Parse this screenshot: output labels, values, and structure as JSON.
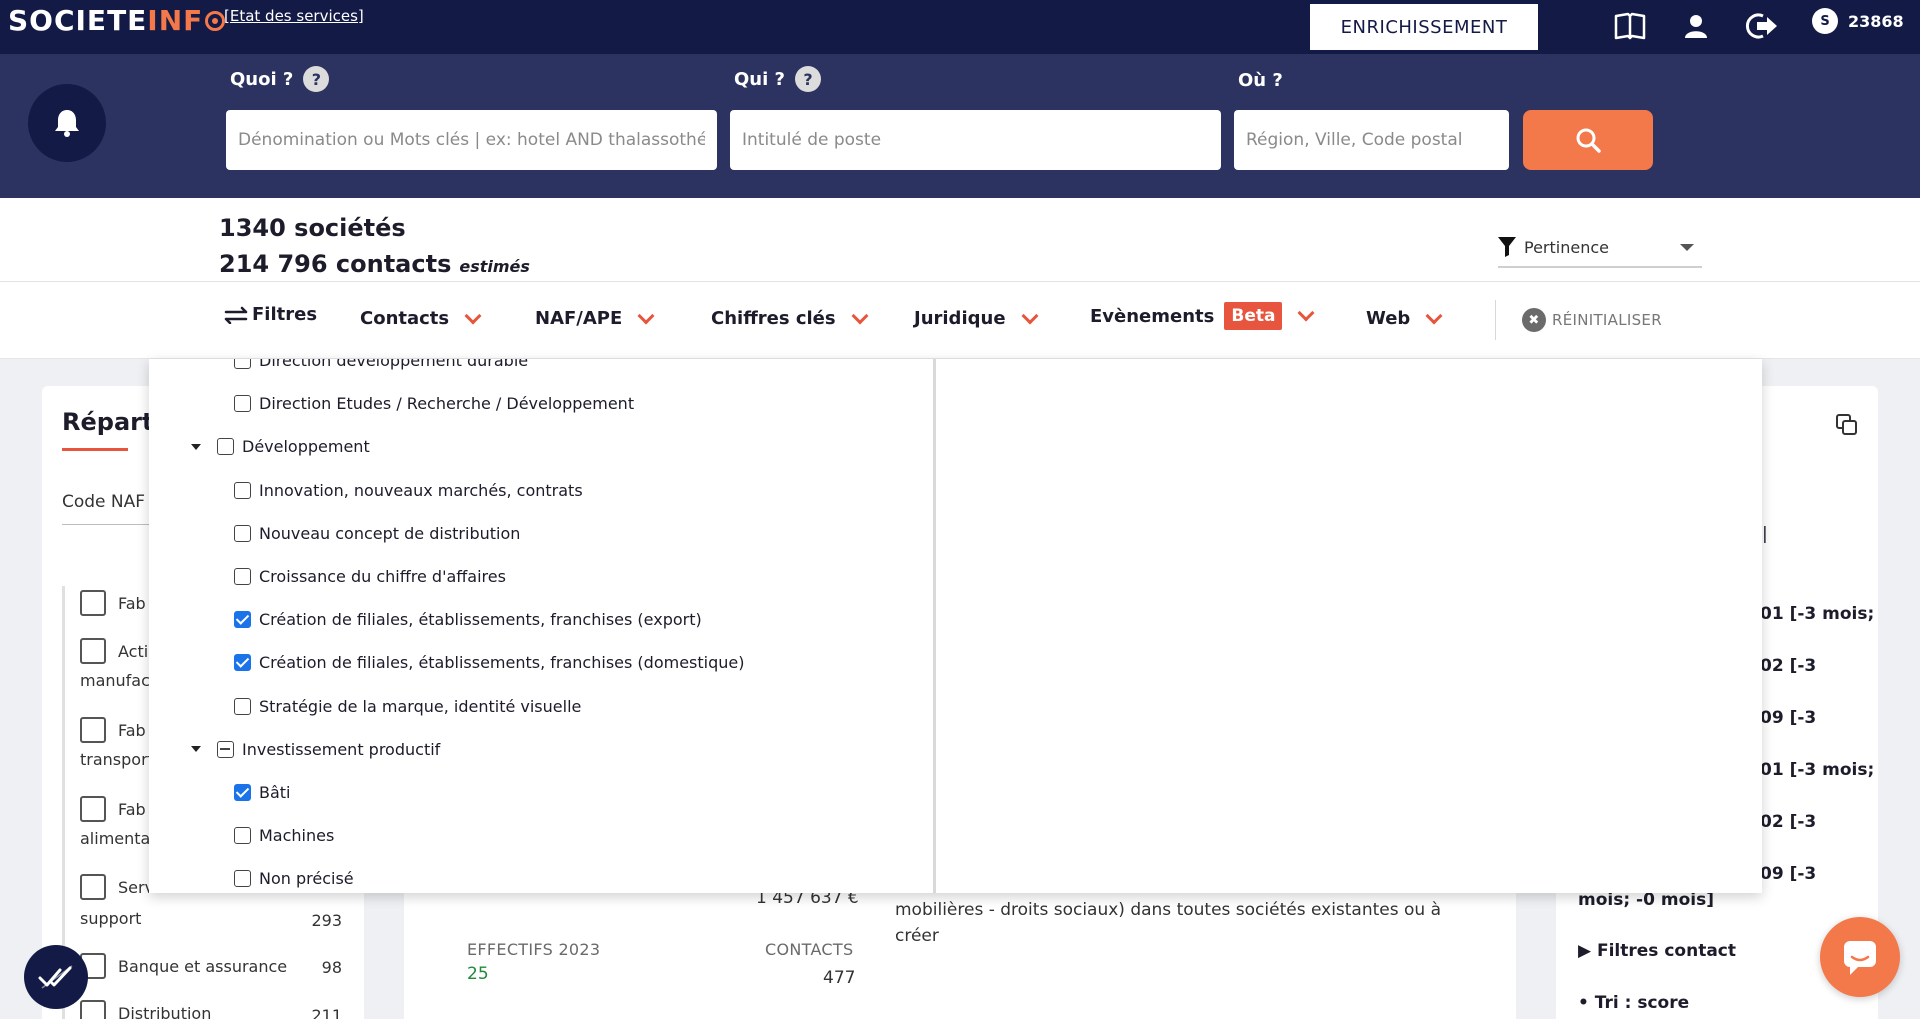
{
  "topbar": {
    "logo_part1": "SOCIETE",
    "logo_part2": "INF",
    "services_link": "[Etat des services]",
    "enrich_button": "ENRICHISSEMENT",
    "credits": "23868",
    "coin_letter": "S"
  },
  "search": {
    "quoi_label": "Quoi ?",
    "qui_label": "Qui ?",
    "ou_label": "Où ?",
    "help_glyph": "?",
    "quoi_placeholder": "Dénomination ou Mots clés | ex: hotel AND thalassothérapie",
    "qui_placeholder": "Intitulé de poste",
    "ou_placeholder": "Région, Ville, Code postal"
  },
  "results": {
    "companies": "1340 sociétés",
    "contacts": "214 796 contacts",
    "estimated": "estimés",
    "sort_label": "Pertinence"
  },
  "filters": {
    "filtres": "Filtres",
    "contacts": "Contacts",
    "naf": "NAF/APE",
    "chiffres": "Chiffres clés",
    "juridique": "Juridique",
    "evenements": "Evènements",
    "beta": "Beta",
    "web": "Web",
    "reset": "RÉINITIALISER",
    "reset_glyph": "✖"
  },
  "dropdown": {
    "items": [
      {
        "label": "Direction développement durable",
        "state": "unchecked",
        "level": 2
      },
      {
        "label": "Direction Etudes / Recherche / Développement",
        "state": "unchecked",
        "level": 2
      },
      {
        "label": "Développement",
        "state": "unchecked",
        "level": 1
      },
      {
        "label": "Innovation, nouveaux marchés, contrats",
        "state": "unchecked",
        "level": 2
      },
      {
        "label": "Nouveau concept de distribution",
        "state": "unchecked",
        "level": 2
      },
      {
        "label": "Croissance du chiffre d'affaires",
        "state": "unchecked",
        "level": 2
      },
      {
        "label": "Création de filiales, établissements, franchises (export)",
        "state": "checked",
        "level": 2
      },
      {
        "label": "Création de filiales, établissements, franchises (domestique)",
        "state": "checked",
        "level": 2
      },
      {
        "label": "Stratégie de la marque, identité visuelle",
        "state": "unchecked",
        "level": 2
      },
      {
        "label": "Investissement productif",
        "state": "partial",
        "level": 1
      },
      {
        "label": "Bâti",
        "state": "checked",
        "level": 2
      },
      {
        "label": "Machines",
        "state": "unchecked",
        "level": 2
      },
      {
        "label": "Non précisé",
        "state": "unchecked",
        "level": 2
      }
    ]
  },
  "left_panel": {
    "title": "Répart",
    "naf_label": "Code NAF",
    "rows": [
      {
        "label": "Fab",
        "sub": "",
        "count": ""
      },
      {
        "label": "Acti",
        "sub": "manufac",
        "count": ""
      },
      {
        "label": "Fab",
        "sub": "transport",
        "count": ""
      },
      {
        "label": "Fab",
        "sub": "alimenta",
        "count": ""
      },
      {
        "label": "Serv",
        "sub": "support",
        "count": "293"
      },
      {
        "label": "Banque et assurance",
        "sub": "",
        "count": "98"
      },
      {
        "label": "Distribution",
        "sub": "",
        "count": "211"
      }
    ]
  },
  "middle": {
    "amount": "1 457 637 €",
    "effectifs_label": "EFFECTIFS 2023",
    "effectifs_value": "25",
    "contacts_label": "CONTACTS",
    "contacts_value": "477",
    "desc_line1": "mobilières - droits sociaux) dans toutes sociétés existantes ou à",
    "desc_line2": "créer"
  },
  "right_panel": {
    "line1": "01 [-3 mois;",
    "line2": "02 [-3",
    "line3": "09 [-3",
    "line4": "01 [-3 mois;",
    "line5": "02 [-3",
    "line6": "09 [-3",
    "line7": "mois; -0 mois]",
    "filtres_contact": "▶ Filtres contact",
    "tri": "• Tri : score",
    "bar": "|"
  },
  "colors": {
    "navy": "#131a45",
    "search_band": "#2c3360",
    "accent": "#f3784a",
    "red": "#e8553f",
    "check_blue": "#1a73e8"
  }
}
